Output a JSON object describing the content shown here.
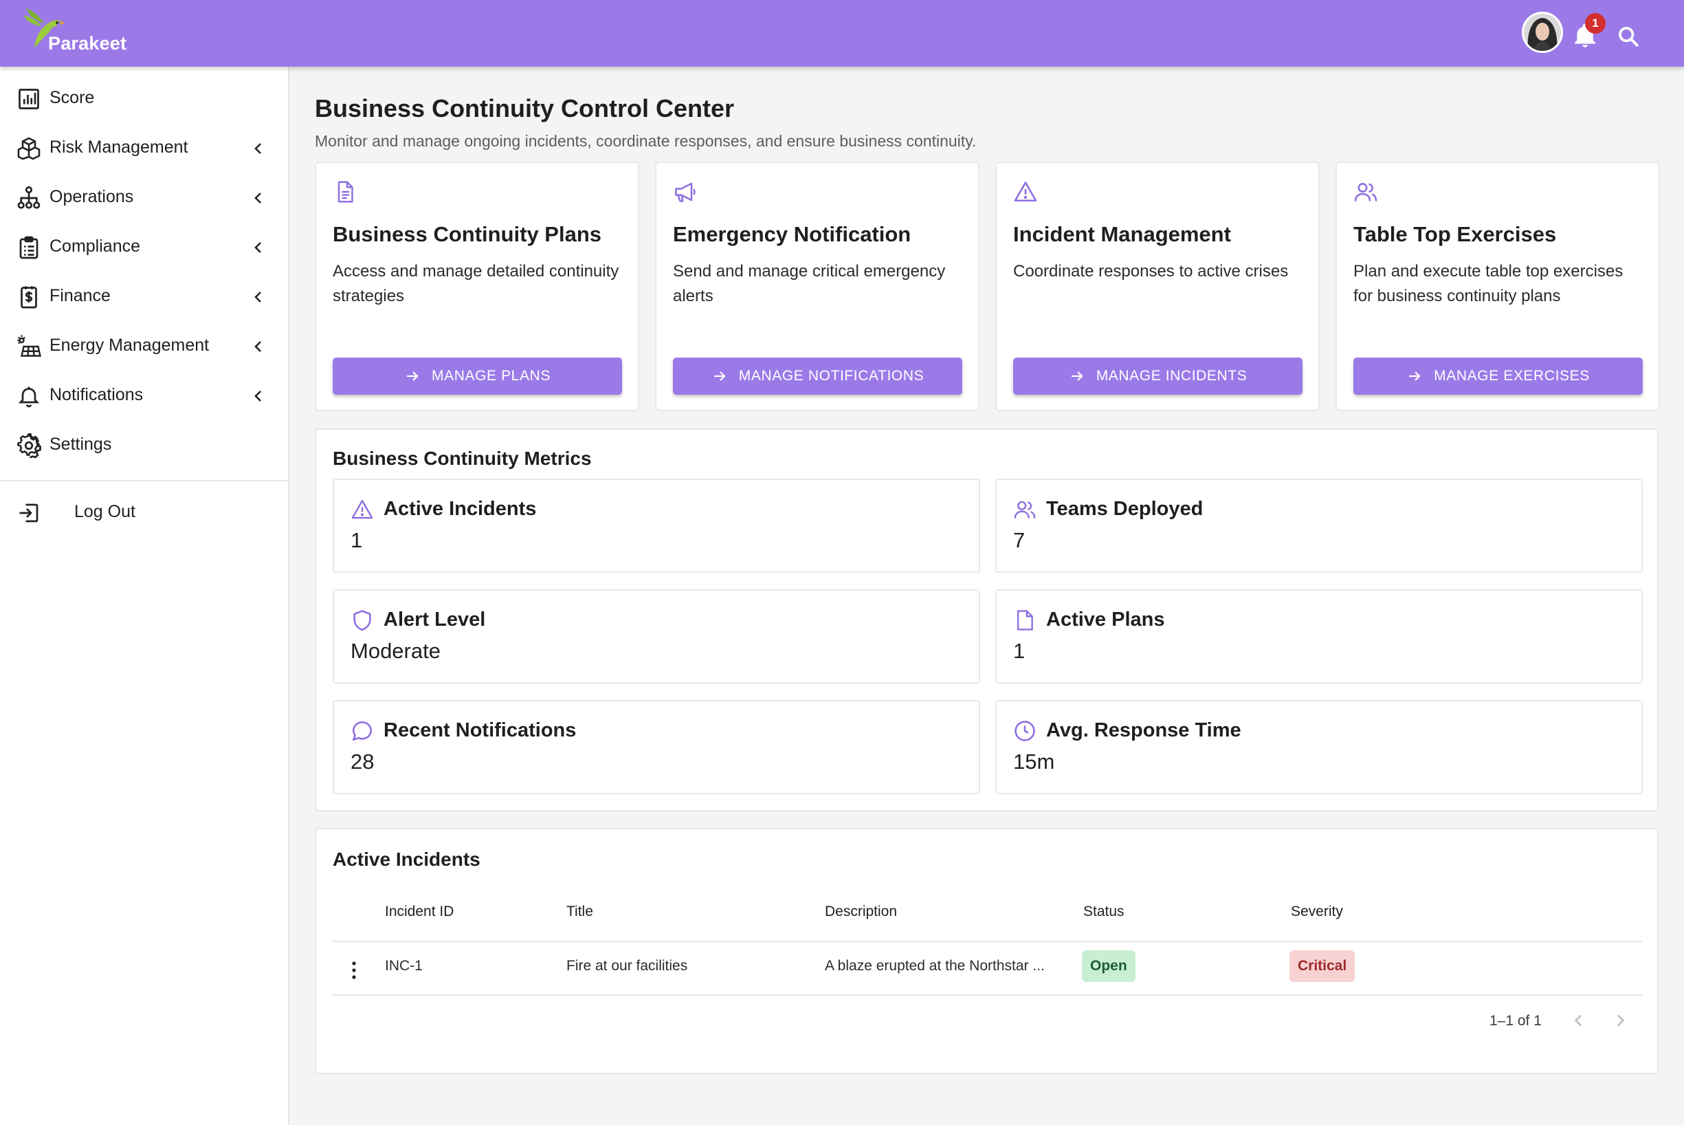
{
  "app": {
    "name": "Parakeet",
    "notification_count": "1"
  },
  "colors": {
    "brand": "#9b7ae8",
    "icon_purple": "#8d6ee0",
    "status_open_bg": "#c8efd3",
    "status_critical_bg": "#f8d2d2"
  },
  "sidebar": {
    "items": [
      {
        "label": "Score",
        "icon": "bar-chart-icon",
        "expandable": false
      },
      {
        "label": "Risk Management",
        "icon": "cubes-icon",
        "expandable": true
      },
      {
        "label": "Operations",
        "icon": "org-tree-icon",
        "expandable": true
      },
      {
        "label": "Compliance",
        "icon": "clipboard-list-icon",
        "expandable": true
      },
      {
        "label": "Finance",
        "icon": "dollar-receipt-icon",
        "expandable": true
      },
      {
        "label": "Energy Management",
        "icon": "solar-panel-icon",
        "expandable": true
      },
      {
        "label": "Notifications",
        "icon": "bell-icon",
        "expandable": true
      },
      {
        "label": "Settings",
        "icon": "gear-icon",
        "expandable": false
      }
    ],
    "logout": {
      "label": "Log Out",
      "icon": "logout-icon"
    }
  },
  "header": {
    "title": "Business Continuity Control Center",
    "subtitle": "Monitor and manage ongoing incidents, coordinate responses, and ensure business continuity."
  },
  "feature_cards": [
    {
      "icon": "document-icon",
      "title": "Business Continuity Plans",
      "description": "Access and manage detailed continuity strategies",
      "button": "Manage Plans"
    },
    {
      "icon": "megaphone-icon",
      "title": "Emergency Notification",
      "description": "Send and manage critical emergency alerts",
      "button": "Manage Notifications"
    },
    {
      "icon": "warning-triangle-icon",
      "title": "Incident Management",
      "description": "Coordinate responses to active crises",
      "button": "Manage Incidents"
    },
    {
      "icon": "users-icon",
      "title": "Table Top Exercises",
      "description": "Plan and execute table top exercises for business continuity plans",
      "button": "Manage Exercises"
    }
  ],
  "metrics": {
    "title": "Business Continuity Metrics",
    "items": [
      {
        "icon": "warning-triangle-icon",
        "label": "Active Incidents",
        "value": "1"
      },
      {
        "icon": "users-icon",
        "label": "Teams Deployed",
        "value": "7"
      },
      {
        "icon": "shield-icon",
        "label": "Alert Level",
        "value": "Moderate"
      },
      {
        "icon": "document-icon",
        "label": "Active Plans",
        "value": "1"
      },
      {
        "icon": "chat-bubble-icon",
        "label": "Recent Notifications",
        "value": "28"
      },
      {
        "icon": "clock-icon",
        "label": "Avg. Response Time",
        "value": "15m"
      }
    ]
  },
  "incidents": {
    "title": "Active Incidents",
    "columns": [
      "Incident ID",
      "Title",
      "Description",
      "Status",
      "Severity"
    ],
    "rows": [
      {
        "id": "INC-1",
        "title": "Fire at our facilities",
        "description": "A blaze erupted at the Northstar ...",
        "status": "Open",
        "severity": "Critical"
      }
    ],
    "pagination": "1–1 of 1"
  }
}
